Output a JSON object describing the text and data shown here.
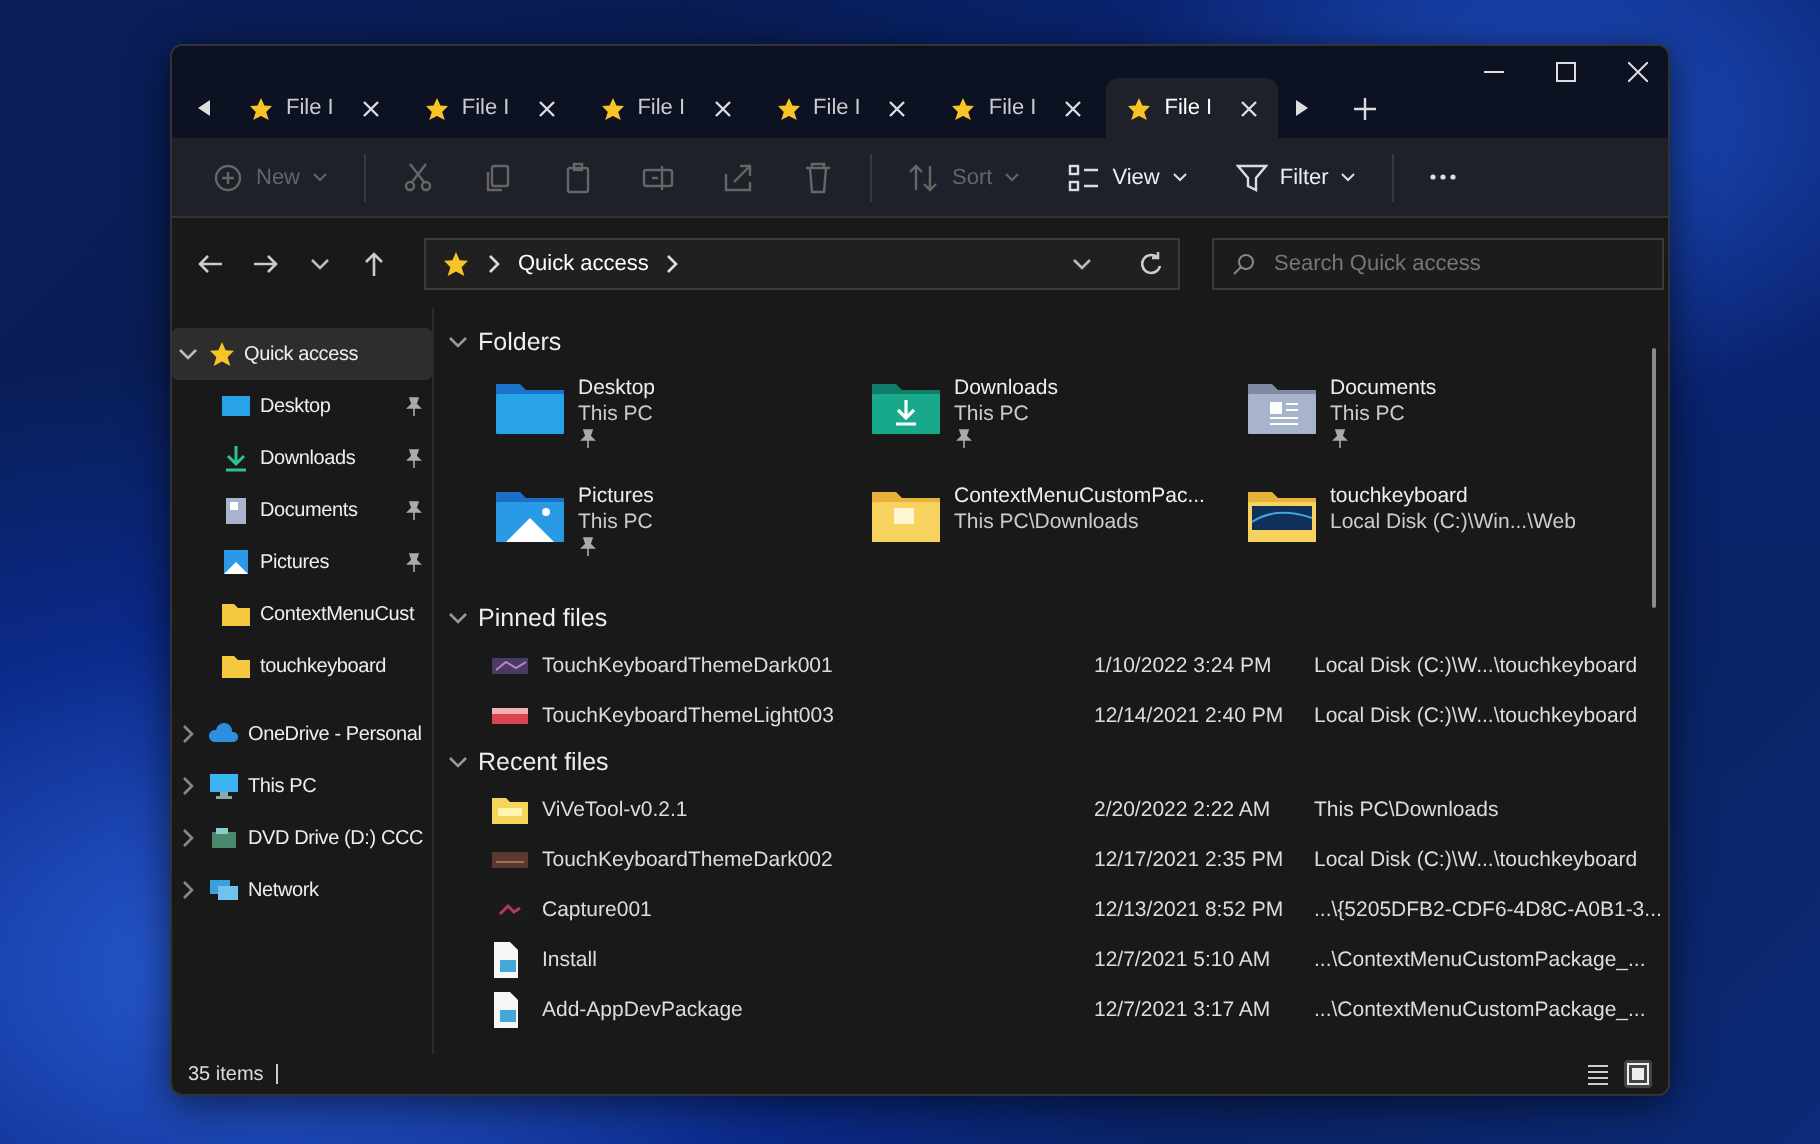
{
  "tabs": [
    {
      "label": "File I",
      "selected": false
    },
    {
      "label": "File I",
      "selected": false
    },
    {
      "label": "File I",
      "selected": false
    },
    {
      "label": "File I",
      "selected": false
    },
    {
      "label": "File I",
      "selected": false
    },
    {
      "label": "File I",
      "selected": true
    }
  ],
  "toolbar": [
    {
      "kind": "new",
      "label": "New",
      "disabled": true
    },
    {
      "kind": "cut",
      "disabled": true
    },
    {
      "kind": "copy",
      "disabled": true
    },
    {
      "kind": "paste",
      "disabled": true
    },
    {
      "kind": "rename",
      "disabled": true
    },
    {
      "kind": "share",
      "disabled": true
    },
    {
      "kind": "delete",
      "disabled": true
    },
    {
      "kind": "sort",
      "label": "Sort",
      "disabled": true
    },
    {
      "kind": "view",
      "label": "View",
      "disabled": false
    },
    {
      "kind": "filter",
      "label": "Filter",
      "disabled": false
    },
    {
      "kind": "more",
      "disabled": false
    }
  ],
  "address": {
    "location": "Quick access",
    "search_placeholder": "Search Quick access"
  },
  "sidebar": [
    {
      "label": "Quick access",
      "kind": "star",
      "expanded": true,
      "selected": true,
      "children": [
        {
          "label": "Desktop",
          "kind": "desktop",
          "pinned": true
        },
        {
          "label": "Downloads",
          "kind": "download",
          "pinned": true
        },
        {
          "label": "Documents",
          "kind": "document",
          "pinned": true
        },
        {
          "label": "Pictures",
          "kind": "picture",
          "pinned": true
        },
        {
          "label": "ContextMenuCust",
          "kind": "folder",
          "pinned": false
        },
        {
          "label": "touchkeyboard",
          "kind": "folder",
          "pinned": false
        }
      ]
    },
    {
      "label": "OneDrive - Personal",
      "kind": "cloud",
      "expanded": false,
      "selected": false
    },
    {
      "label": "This PC",
      "kind": "pc",
      "expanded": false,
      "selected": false
    },
    {
      "label": "DVD Drive (D:) CCC",
      "kind": "dvd",
      "expanded": false,
      "selected": false
    },
    {
      "label": "Network",
      "kind": "network",
      "expanded": false,
      "selected": false
    }
  ],
  "sections": [
    {
      "title": "Folders",
      "kind": "folders",
      "expanded": true,
      "items": [
        {
          "name": "Desktop",
          "location": "This PC",
          "kind": "desktop",
          "pinned": true
        },
        {
          "name": "Downloads",
          "location": "This PC",
          "kind": "download",
          "pinned": true
        },
        {
          "name": "Documents",
          "location": "This PC",
          "kind": "document",
          "pinned": true
        },
        {
          "name": "Pictures",
          "location": "This PC",
          "kind": "picture",
          "pinned": true
        },
        {
          "name": "ContextMenuCustomPac...",
          "location": "This PC\\Downloads",
          "kind": "folder",
          "pinned": false
        },
        {
          "name": "touchkeyboard",
          "location": "Local Disk (C:)\\Win...\\Web",
          "kind": "image-folder",
          "pinned": false
        }
      ]
    },
    {
      "title": "Pinned files",
      "kind": "files",
      "expanded": true,
      "items": [
        {
          "name": "TouchKeyboardThemeDark001",
          "date": "1/10/2022 3:24 PM",
          "location": "Local Disk (C:)\\W...\\touchkeyboard",
          "kind": "purple-image"
        },
        {
          "name": "TouchKeyboardThemeLight003",
          "date": "12/14/2021 2:40 PM",
          "location": "Local Disk (C:)\\W...\\touchkeyboard",
          "kind": "red-image"
        }
      ]
    },
    {
      "title": "Recent files",
      "kind": "files",
      "expanded": true,
      "items": [
        {
          "name": "ViVeTool-v0.2.1",
          "date": "2/20/2022 2:22 AM",
          "location": "This PC\\Downloads",
          "kind": "zip"
        },
        {
          "name": "TouchKeyboardThemeDark002",
          "date": "12/17/2021 2:35 PM",
          "location": "Local Disk (C:)\\W...\\touchkeyboard",
          "kind": "brown-image"
        },
        {
          "name": "Capture001",
          "date": "12/13/2021 8:52 PM",
          "location": "...\\{5205DFB2-CDF6-4D8C-A0B1-3...",
          "kind": "capture"
        },
        {
          "name": "Install",
          "date": "12/7/2021 5:10 AM",
          "location": "...\\ContextMenuCustomPackage_...",
          "kind": "script"
        },
        {
          "name": "Add-AppDevPackage",
          "date": "12/7/2021 3:17 AM",
          "location": "...\\ContextMenuCustomPackage_...",
          "kind": "script"
        }
      ]
    }
  ],
  "status": {
    "count": "35 items",
    "views": [
      {
        "kind": "details",
        "selected": false
      },
      {
        "kind": "tiles",
        "selected": true
      }
    ]
  }
}
